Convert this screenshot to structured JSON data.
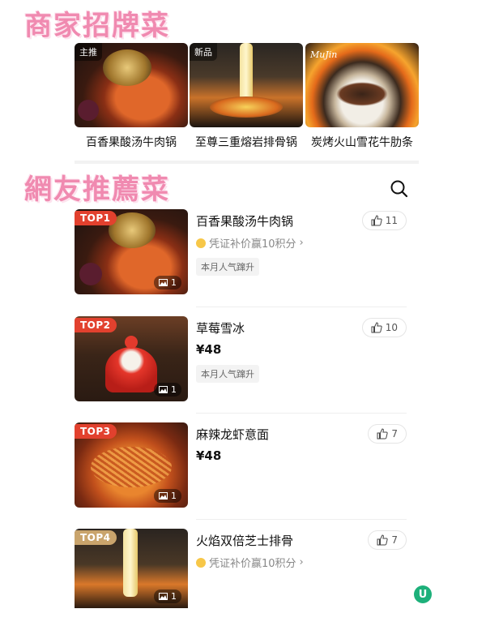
{
  "headings": {
    "signature": "商家招牌菜",
    "netizen": "網友推薦菜"
  },
  "signature_dishes": [
    {
      "name": "百香果酸汤牛肉锅",
      "tag": "主推"
    },
    {
      "name": "至尊三重熔岩排骨锅",
      "tag": "新品"
    },
    {
      "name": "炭烤火山雪花牛肋条",
      "tag": ""
    }
  ],
  "ranked": [
    {
      "rank": "TOP1",
      "name": "百香果酸汤牛肉锅",
      "likes": "11",
      "sub": "凭证补价赢10积分",
      "sub_arrow": "›",
      "price": "",
      "chip": "本月人气蹿升",
      "photos": "1"
    },
    {
      "rank": "TOP2",
      "name": "草莓雪冰",
      "likes": "10",
      "sub": "",
      "sub_arrow": "",
      "price": "¥48",
      "chip": "本月人气蹿升",
      "photos": "1"
    },
    {
      "rank": "TOP3",
      "name": "麻辣龙虾意面",
      "likes": "7",
      "sub": "",
      "sub_arrow": "",
      "price": "¥48",
      "chip": "",
      "photos": "1"
    },
    {
      "rank": "TOP4",
      "name": "火焰双倍芝士排骨",
      "likes": "7",
      "sub": "凭证补价赢10积分",
      "sub_arrow": "›",
      "price": "",
      "chip": "",
      "photos": "1"
    }
  ],
  "corner_logo": "U",
  "colors": {
    "heading_pink": "#f08ab0",
    "rank_red": "#e2412e",
    "rank_gold": "#c9a46c"
  }
}
